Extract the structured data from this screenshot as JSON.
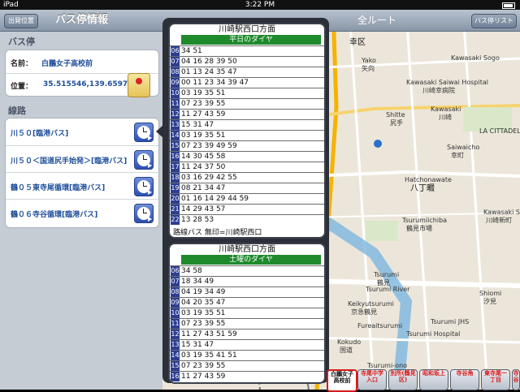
{
  "status": {
    "left": "iPad",
    "time": "3:22 PM"
  },
  "header": {
    "back_label": "出発位置",
    "title": "バス停情報",
    "map_title": "全ルート",
    "list_label": "バス停リスト"
  },
  "busstop": {
    "section": "バス停",
    "name_label": "名前：",
    "name": "白鵬女子高校前",
    "pos_label": "位置：",
    "pos": "35.515546,139.659758"
  },
  "routes": {
    "section": "線路",
    "items": [
      {
        "label": "川５０[臨港バス]"
      },
      {
        "label": "川５０＜国道尻手始発＞[臨港バス]"
      },
      {
        "label": "鶴０５東寺尾循環[臨港バス]"
      },
      {
        "label": "鶴０６寺谷循環[臨港バス]"
      }
    ]
  },
  "timetable1": {
    "dest": "川崎駅西口方面",
    "type": "平日のダイヤ",
    "rows": [
      {
        "h": "06",
        "m": "34 51"
      },
      {
        "h": "07",
        "m": "04 16 28 39 50"
      },
      {
        "h": "08",
        "m": "01 13 24 35 47"
      },
      {
        "h": "09",
        "m": "00 11 23 34 39 47"
      },
      {
        "h": "10",
        "m": "03 19 35 51"
      },
      {
        "h": "11",
        "m": "07 23 39 55"
      },
      {
        "h": "12",
        "m": "11 27 43 59"
      },
      {
        "h": "13",
        "m": "15 31 47"
      },
      {
        "h": "14",
        "m": "03 19 35 51"
      },
      {
        "h": "15",
        "m": "07 23 39 49 59"
      },
      {
        "h": "16",
        "m": "14 30 45 58"
      },
      {
        "h": "17",
        "m": "11 24 37 50"
      },
      {
        "h": "18",
        "m": "03 16 29 42 55"
      },
      {
        "h": "19",
        "m": "08 21 34 47"
      },
      {
        "h": "20",
        "m": "01 16 14 29 44 59"
      },
      {
        "h": "21",
        "m": "14 29 43 57"
      },
      {
        "h": "22",
        "m": "13 28 53"
      }
    ],
    "note": "路線バス 無印=川崎駅西口"
  },
  "timetable2": {
    "dest": "川崎駅西口方面",
    "type": "土曜のダイヤ",
    "rows": [
      {
        "h": "06",
        "m": "34 58"
      },
      {
        "h": "07",
        "m": "18 34 49"
      },
      {
        "h": "08",
        "m": "04 19 34 49"
      },
      {
        "h": "09",
        "m": "04 20 35 47"
      },
      {
        "h": "10",
        "m": "03 19 35 51"
      },
      {
        "h": "11",
        "m": "07 23 39 55"
      },
      {
        "h": "12",
        "m": "11 27 43 51 59"
      },
      {
        "h": "13",
        "m": "15 31 47"
      },
      {
        "h": "14",
        "m": "03 19 35 41 51"
      },
      {
        "h": "15",
        "m": "07 23 39 55"
      },
      {
        "h": "16",
        "m": "11 27 43 59"
      }
    ]
  },
  "map_labels": [
    "幸区",
    "Yako",
    "矢向",
    "Kawasaki Saiwai Hospital",
    "川崎幸病院",
    "Shitte",
    "尻手",
    "Kawasaki",
    "川崎",
    "Hatchonawate",
    "八丁畷",
    "Tsurumiichiba",
    "鶴見市場",
    "Tsurumi",
    "鶴見",
    "Keikyutsurumi",
    "京急鶴見",
    "Tsurumi River",
    "Kokudo",
    "国道",
    "Tsurumi-ono",
    "LA CITTADELLA",
    "Kawasaki Shinmachi",
    "川崎新町",
    "Saiwaicho",
    "幸町",
    "Shiomi",
    "汐見",
    "Kawasaki Sogo",
    "Tsurumi Hospital",
    "Tsurumi JHS",
    "Fureaitsurumi"
  ],
  "bottom_stops": [
    {
      "label": "白鵬女子高校前",
      "selected": true
    },
    {
      "label": "寺尾中学入口",
      "selected": false
    },
    {
      "label": "別所(鶴見区)",
      "selected": false
    },
    {
      "label": "昭和坂上",
      "selected": false
    },
    {
      "label": "寺谷角",
      "selected": false
    },
    {
      "label": "東寺尾一丁目",
      "selected": false
    },
    {
      "label": "寺谷",
      "selected": false
    }
  ]
}
